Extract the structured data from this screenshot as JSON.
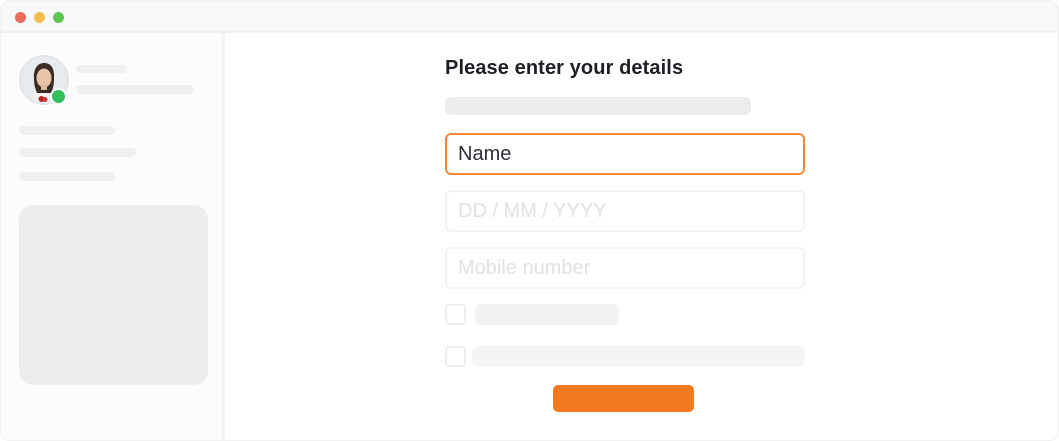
{
  "colors": {
    "traffic_red": "#ec6a5e",
    "traffic_yellow": "#f4bf4f",
    "traffic_green": "#61c554",
    "presence_online": "#2fbf5b",
    "accent": "#f47a20"
  },
  "sidebar": {
    "avatar_icon": "user-avatar-photo",
    "presence_status": "online"
  },
  "form": {
    "title": "Please enter your details",
    "name_value": "Name",
    "dob_placeholder": "DD / MM / YYYY",
    "mobile_placeholder": "Mobile number"
  }
}
